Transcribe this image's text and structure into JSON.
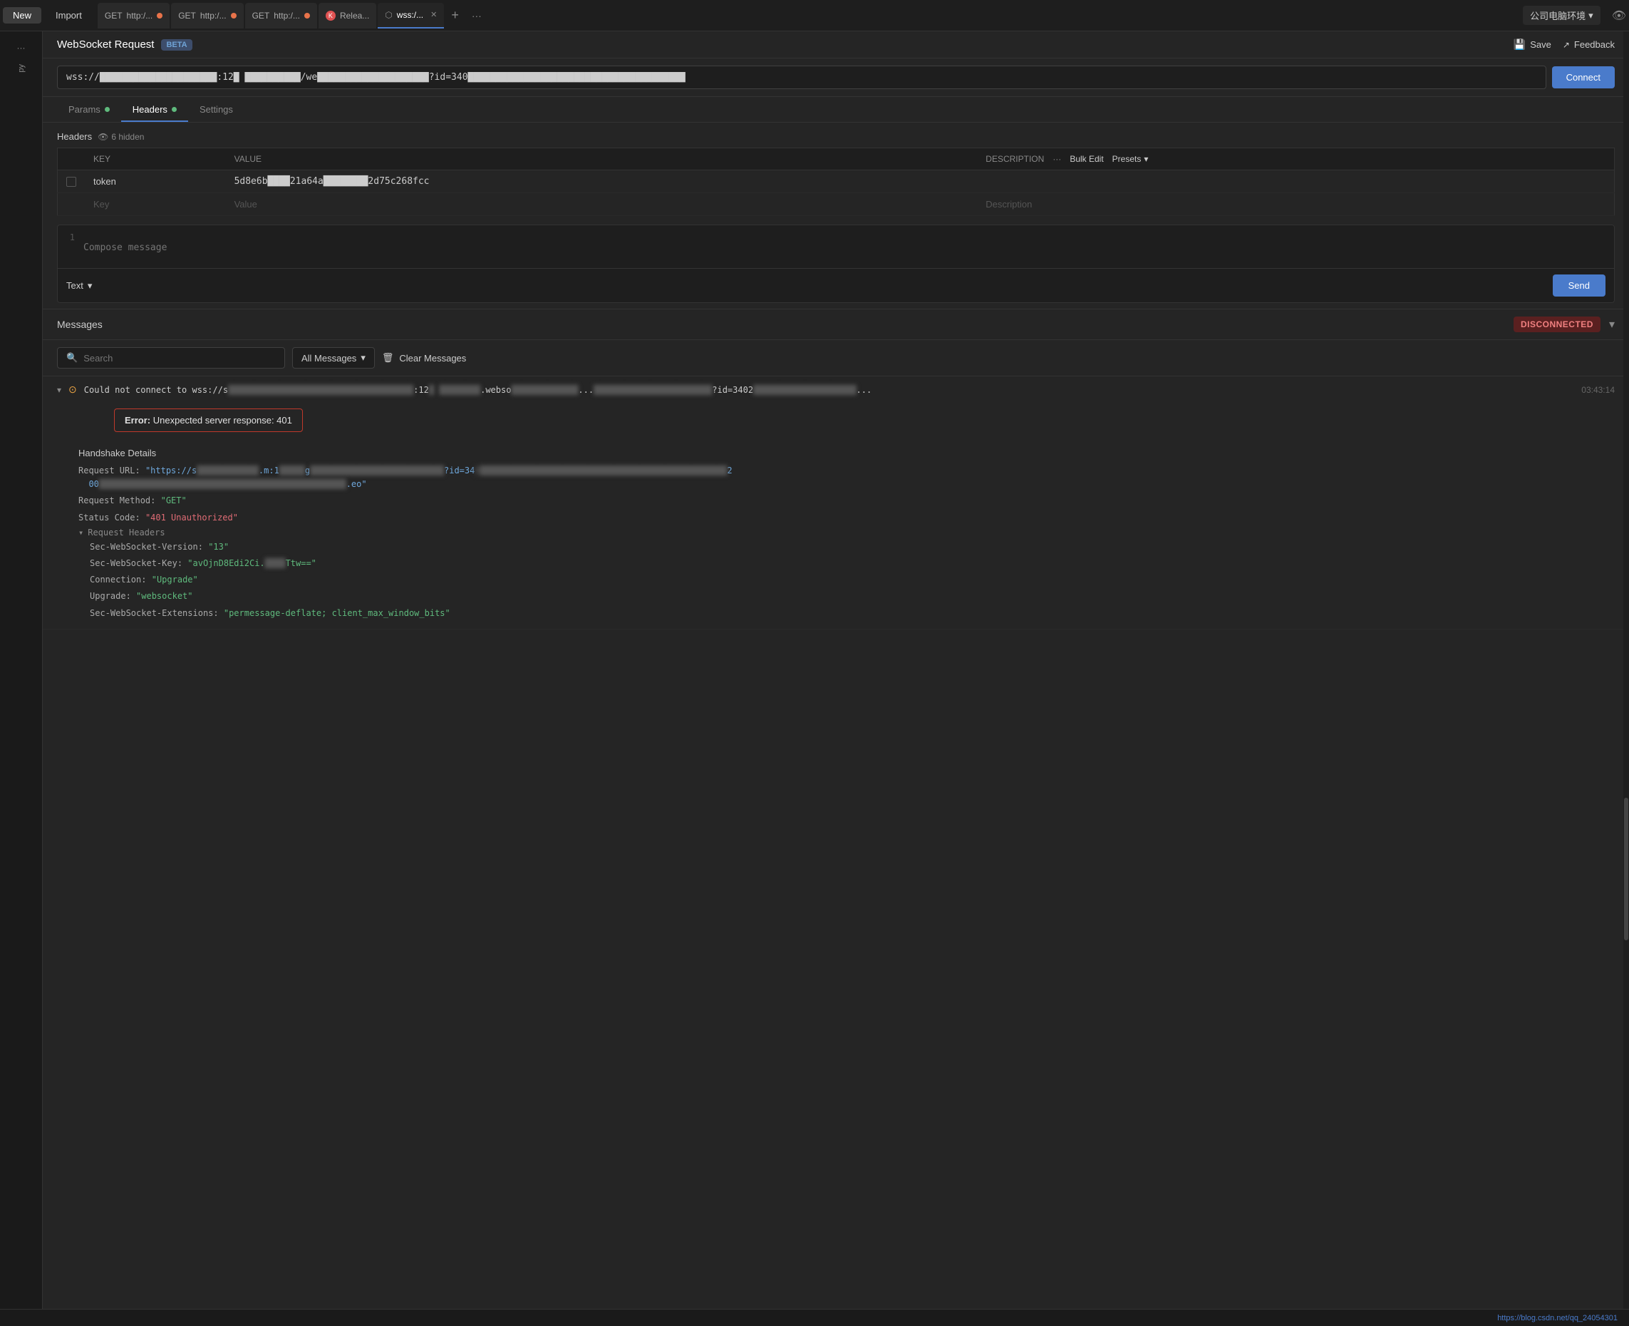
{
  "app": {
    "title": "WebSocket Request",
    "beta_label": "BETA"
  },
  "tabbar": {
    "new_label": "New",
    "import_label": "Import",
    "tabs": [
      {
        "id": "get1",
        "method": "GET",
        "url": "http:/...",
        "dot": "orange",
        "active": false
      },
      {
        "id": "get2",
        "method": "GET",
        "url": "http:/...",
        "dot": "orange",
        "active": false
      },
      {
        "id": "get3",
        "method": "GET",
        "url": "http:/...",
        "dot": "orange",
        "active": false
      },
      {
        "id": "relea",
        "method": "",
        "url": "Relea...",
        "dot": "green",
        "active": false
      },
      {
        "id": "wss",
        "method": "",
        "url": "wss:/...",
        "dot": "none",
        "active": true
      }
    ],
    "add_tab_label": "+",
    "more_label": "···",
    "env_label": "公司电脑环境",
    "env_chevron": "▾"
  },
  "header": {
    "title": "WebSocket Request",
    "beta": "BETA",
    "save_label": "Save",
    "feedback_label": "Feedback"
  },
  "url_bar": {
    "value": "wss://█████████████████████:12█ ██████████/we████████████████████?id=340███████████████████████████████████████",
    "connect_label": "Connect"
  },
  "req_tabs": {
    "items": [
      {
        "id": "params",
        "label": "Params",
        "has_dot": true,
        "active": false
      },
      {
        "id": "headers",
        "label": "Headers",
        "has_dot": true,
        "active": true
      },
      {
        "id": "settings",
        "label": "Settings",
        "has_dot": false,
        "active": false
      }
    ]
  },
  "headers": {
    "section_label": "Headers",
    "hidden_count": "6 hidden",
    "columns": {
      "key": "KEY",
      "value": "VALUE",
      "description": "DESCRIPTION",
      "more": "···",
      "bulk_edit": "Bulk Edit",
      "presets": "Presets"
    },
    "rows": [
      {
        "key": "token",
        "value": "5d8e6b████21a64a████████2d75c268fcc",
        "description": ""
      },
      {
        "key": "",
        "value": "",
        "description": ""
      }
    ],
    "key_placeholder": "Key",
    "value_placeholder": "Value",
    "desc_placeholder": "Description"
  },
  "composer": {
    "line_number": "1",
    "placeholder": "Compose message",
    "type_label": "Text",
    "send_label": "Send"
  },
  "messages": {
    "section_title": "Messages",
    "disconnected_label": "DISCONNECTED",
    "search_placeholder": "Search",
    "filter_label": "All Messages",
    "clear_label": "Clear Messages",
    "entries": [
      {
        "type": "error",
        "chevron": "▾",
        "warn": "⊙",
        "text": "Could not connect to wss://s██████████.████████████:12█ █████████.webso████████.███████████████?id=3402██████████████████████████...",
        "time": "03:43:14",
        "error_box": "Error: Unexpected server response: 401",
        "error_bold": "Error:",
        "error_msg": " Unexpected server response: 401",
        "handshake": {
          "title": "Handshake Details",
          "request_url_label": "Request URL:",
          "request_url_val": "\"https://s████████aps.████████████.m:1█████g████████████████████.███████?id=34 0████████████████████████████████████████████████2\n00█████████████████████████████.█████████████.eo\"",
          "method_label": "Request Method:",
          "method_val": "\"GET\"",
          "status_label": "Status Code:",
          "status_val": "\"401 Unauthorized\"",
          "req_headers_label": "▾ Request Headers",
          "ws_version_label": "Sec-WebSocket-Version:",
          "ws_version_val": "\"13\"",
          "ws_key_label": "Sec-WebSocket-Key:",
          "ws_key_val": "\"avOjnD8Edi2Ci.█████Ttw==\"",
          "connection_label": "Connection:",
          "connection_val": "\"Upgrade\"",
          "upgrade_label": "Upgrade:",
          "upgrade_val": "\"websocket\"",
          "more_label": "Sec-WebSocket-Extensions:\"permessage-deflate; client_max_window_bits\""
        }
      }
    ]
  },
  "status_bar": {
    "url": "https://blog.csdn.net/qq_24054301"
  }
}
